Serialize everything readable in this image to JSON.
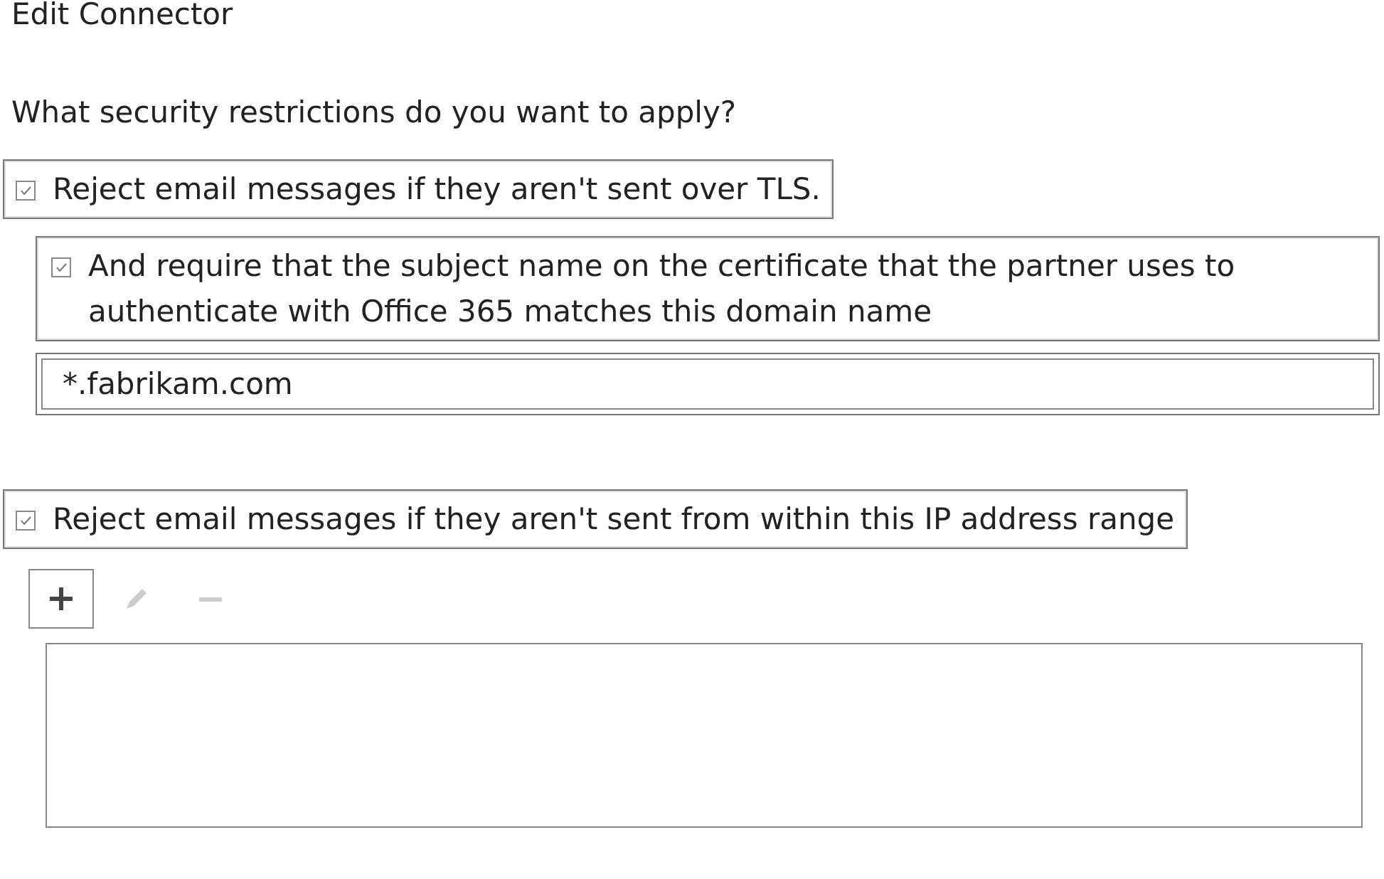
{
  "title": "Edit Connector",
  "question": "What security restrictions do you want to apply?",
  "tls_option": {
    "label": "Reject email messages if they aren't sent over TLS.",
    "checked": true
  },
  "subject_option": {
    "label": "And require that the subject name on the certificate that the partner uses to authenticate with Office 365 matches this domain name",
    "checked": true
  },
  "domain_field": {
    "value": "*.fabrikam.com"
  },
  "ip_option": {
    "label": "Reject email messages if they aren't sent from within this IP address range",
    "checked": true
  },
  "toolbar": [
    {
      "kind": "add",
      "disabled": false
    },
    {
      "kind": "edit",
      "disabled": true
    },
    {
      "kind": "remove",
      "disabled": true
    }
  ]
}
